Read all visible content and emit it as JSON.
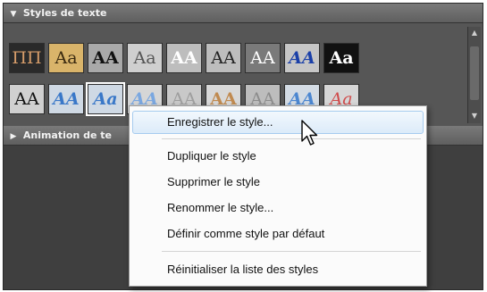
{
  "panel_title": "Styles de texte",
  "collapsed_section": "Animation de te",
  "tiles_row1": [
    {
      "text": "ΠΠ",
      "color": "#d79d6a",
      "bg": "#2a2a2a",
      "weight": "normal",
      "style": "normal"
    },
    {
      "text": "Aa",
      "color": "#3a2a10",
      "bg": "#d9b46a",
      "weight": "normal",
      "style": "normal"
    },
    {
      "text": "AA",
      "color": "#111111",
      "bg": "#a9a9a9",
      "weight": "bold",
      "style": "normal"
    },
    {
      "text": "Aa",
      "color": "#555555",
      "bg": "#cfcfcf",
      "weight": "normal",
      "style": "normal"
    },
    {
      "text": "AA",
      "color": "#ffffff",
      "bg": "#bdbdbd",
      "weight": "bold",
      "style": "normal"
    },
    {
      "text": "AA",
      "color": "#222222",
      "bg": "#bdbdbd",
      "weight": "normal",
      "style": "normal"
    },
    {
      "text": "AA",
      "color": "#ffffff",
      "bg": "#7a7a7a",
      "weight": "normal",
      "style": "normal"
    },
    {
      "text": "AA",
      "color": "#1a3fa8",
      "bg": "#c6c6c6",
      "weight": "bold",
      "style": "italic"
    },
    {
      "text": "Aa",
      "color": "#ffffff",
      "bg": "#111111",
      "weight": "bold",
      "style": "normal"
    }
  ],
  "tiles_row2": [
    {
      "text": "AA",
      "color": "#111111",
      "bg": "#d0d0d0",
      "weight": "normal",
      "style": "normal"
    },
    {
      "text": "AA",
      "color": "#3a78c8",
      "bg": "#cfd9e4",
      "weight": "bold",
      "style": "italic"
    },
    {
      "text": "Aa",
      "color": "#3a78c8",
      "bg": "#cfd9e4",
      "weight": "bold",
      "style": "italic"
    },
    {
      "text": "AA",
      "color": "#7aa7e0",
      "bg": "#d6d6d6",
      "weight": "bold",
      "style": "italic"
    },
    {
      "text": "AA",
      "color": "#9e9e9e",
      "bg": "#c9c9c9",
      "weight": "normal",
      "style": "normal"
    },
    {
      "text": "AA",
      "color": "#c08a50",
      "bg": "#d8d8d8",
      "weight": "bold",
      "style": "normal"
    },
    {
      "text": "AA",
      "color": "#8c8c8c",
      "bg": "#bdbdbd",
      "weight": "normal",
      "style": "normal"
    },
    {
      "text": "AA",
      "color": "#4b86d0",
      "bg": "#d3dbe4",
      "weight": "bold",
      "style": "italic"
    },
    {
      "text": "Aa",
      "color": "#d04a4a",
      "bg": "#d6d6d6",
      "weight": "normal",
      "style": "italic"
    }
  ],
  "selected_tile": "row2-3",
  "menu": {
    "item_save": "Enregistrer le style...",
    "item_duplicate": "Dupliquer le style",
    "item_delete": "Supprimer le style",
    "item_rename": "Renommer le style...",
    "item_default": "Définir comme style par défaut",
    "item_reset": "Réinitialiser la liste des styles"
  },
  "icons": {
    "expanded": "triangle-down-icon",
    "collapsed": "triangle-right-icon",
    "cursor": "mouse-pointer-icon"
  }
}
